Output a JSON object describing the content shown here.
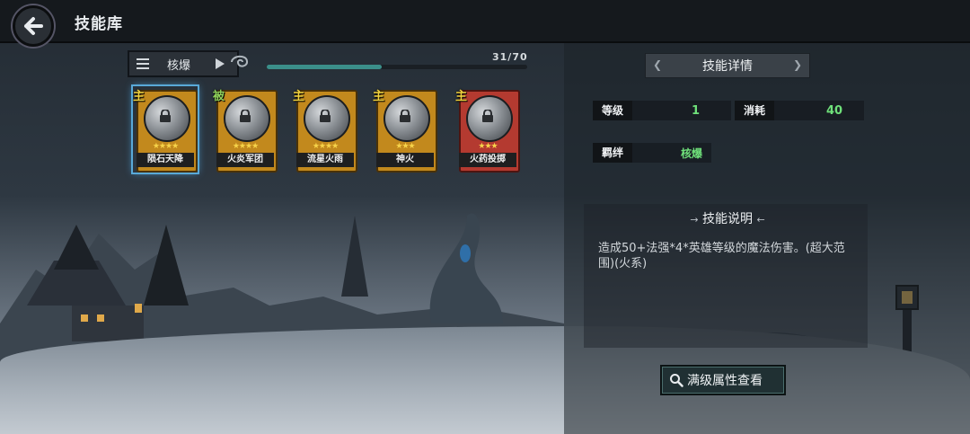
{
  "header": {
    "title": "技能库"
  },
  "filter": {
    "label": "核爆"
  },
  "progress": {
    "text": "31/70",
    "fraction": 0.44
  },
  "skills": [
    {
      "name": "陨石天降",
      "badge": "主",
      "badge_type": "active",
      "stars": "★★★★",
      "frame": "gold",
      "selected": true
    },
    {
      "name": "火炎军团",
      "badge": "被",
      "badge_type": "passive",
      "stars": "★★★★",
      "frame": "gold",
      "selected": false
    },
    {
      "name": "流星火雨",
      "badge": "主",
      "badge_type": "active",
      "stars": "★★★★",
      "frame": "gold",
      "selected": false
    },
    {
      "name": "神火",
      "badge": "主",
      "badge_type": "active",
      "stars": "★★★",
      "frame": "gold",
      "selected": false
    },
    {
      "name": "火药投掷",
      "badge": "主",
      "badge_type": "active",
      "stars": "★★★",
      "frame": "red",
      "selected": false
    }
  ],
  "detail": {
    "title": "技能详情",
    "level_label": "等级",
    "level_value": "1",
    "cost_label": "消耗",
    "cost_value": "40",
    "bond_label": "羁绊",
    "bond_value": "核爆",
    "desc_title": "技能说明",
    "desc_text": "造成50+法强*4*英雄等级的魔法伤害。(超大范围)(火系)",
    "full_button": "满级属性查看"
  },
  "colors": {
    "accent_green": "#6fe07a",
    "gold_frame": "#c2891d",
    "red_frame": "#b43a30",
    "progress": "#3b8f8a"
  }
}
